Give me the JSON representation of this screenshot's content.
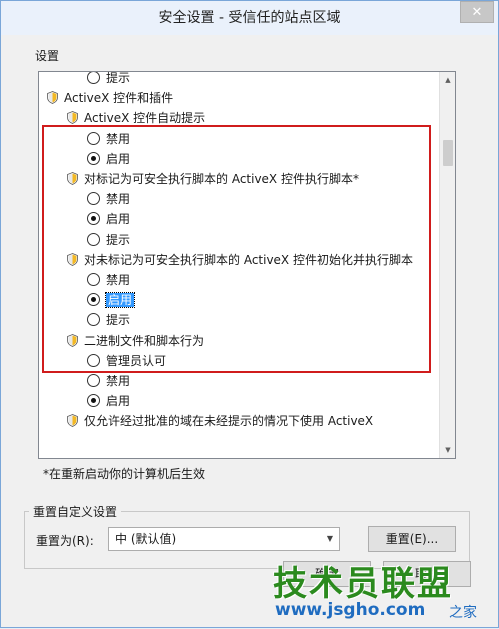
{
  "window": {
    "title": "安全设置 - 受信任的站点区域",
    "close_label": "✕"
  },
  "settings_group": {
    "label": "设置"
  },
  "tree": [
    {
      "kind": "radio",
      "indent": 2,
      "label": "提示",
      "checked": false,
      "partial": true
    },
    {
      "kind": "category",
      "indent": 0,
      "label": "ActiveX 控件和插件"
    },
    {
      "kind": "setting",
      "indent": 1,
      "label": "ActiveX 控件自动提示"
    },
    {
      "kind": "radio",
      "indent": 2,
      "label": "禁用",
      "checked": false
    },
    {
      "kind": "radio",
      "indent": 2,
      "label": "启用",
      "checked": true
    },
    {
      "kind": "setting",
      "indent": 1,
      "label": "对标记为可安全执行脚本的 ActiveX 控件执行脚本*"
    },
    {
      "kind": "radio",
      "indent": 2,
      "label": "禁用",
      "checked": false
    },
    {
      "kind": "radio",
      "indent": 2,
      "label": "启用",
      "checked": true
    },
    {
      "kind": "radio",
      "indent": 2,
      "label": "提示",
      "checked": false
    },
    {
      "kind": "setting",
      "indent": 1,
      "label": "对未标记为可安全执行脚本的 ActiveX 控件初始化并执行脚本"
    },
    {
      "kind": "radio",
      "indent": 2,
      "label": "禁用",
      "checked": false
    },
    {
      "kind": "radio",
      "indent": 2,
      "label": "启用",
      "checked": true,
      "selected": true
    },
    {
      "kind": "radio",
      "indent": 2,
      "label": "提示",
      "checked": false
    },
    {
      "kind": "setting",
      "indent": 1,
      "label": "二进制文件和脚本行为"
    },
    {
      "kind": "radio",
      "indent": 2,
      "label": "管理员认可",
      "checked": false
    },
    {
      "kind": "radio",
      "indent": 2,
      "label": "禁用",
      "checked": false
    },
    {
      "kind": "radio",
      "indent": 2,
      "label": "启用",
      "checked": true
    },
    {
      "kind": "setting",
      "indent": 1,
      "label": "仅允许经过批准的域在未经提示的情况下使用 ActiveX",
      "partial": true
    }
  ],
  "restart_note": "*在重新启动你的计算机后生效",
  "reset": {
    "group_label": "重置自定义设置",
    "reset_to_label": "重置为(R):",
    "combo_value": "中 (默认值)",
    "reset_button": "重置(E)..."
  },
  "buttons": {
    "ok_label": "确定",
    "cancel_label": "取消"
  },
  "watermark": {
    "main": "技术员联盟",
    "url": "www.jsgho.com",
    "tail": "之家"
  },
  "colors": {
    "highlight_frame": "#d01c1c",
    "selection": "#3399ff"
  },
  "scroll_position": 0.16
}
